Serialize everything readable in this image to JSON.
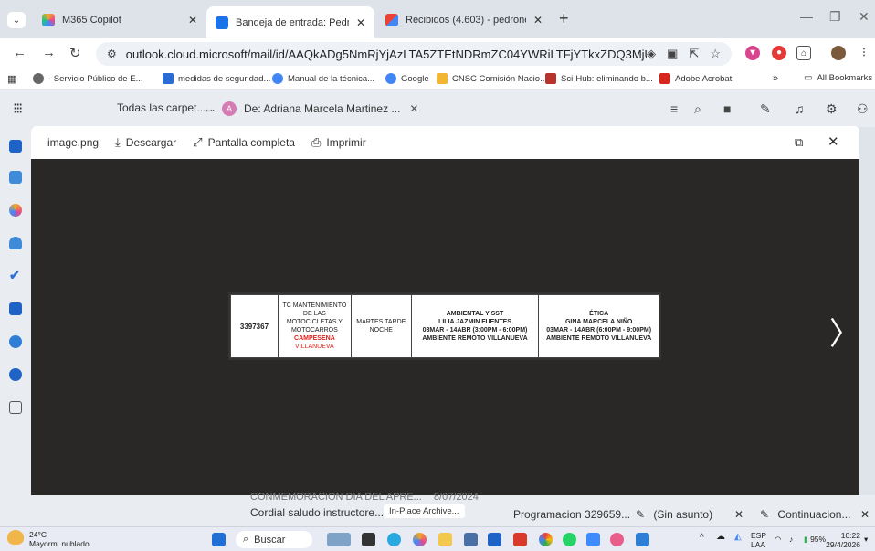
{
  "browser": {
    "tabs": [
      {
        "title": "M365 Copilot",
        "active": false
      },
      {
        "title": "Bandeja de entrada: Pedro Nel Ca",
        "active": true
      },
      {
        "title": "Recibidos (4.603) - pedronel.castr",
        "active": false
      }
    ],
    "new_tab": "+",
    "url": "outlook.cloud.microsoft/mail/id/AAQkADg5NmRjYjAzLTA5ZTEtNDRmZC04YWRiLTFjYTkxZDQ3MjUwYQAQAGj%..."
  },
  "bookmarks": [
    "- Servicio Público de E...",
    "medidas de seguridad...",
    "Manual de la técnica...",
    "Google",
    "CNSC Comisión Nacio...",
    "Sci-Hub: eliminando b...",
    "Adobe Acrobat"
  ],
  "bookmarks_more": "»",
  "all_bookmarks": "All Bookmarks",
  "outlook": {
    "folder_picker": "Todas las carpet...",
    "from_chip_initial": "A",
    "from_chip": "De: Adriana Marcela Martinez ...",
    "viewer": {
      "filename": "image.png",
      "download": "Descargar",
      "fullscreen": "Pantalla completa",
      "print": "Imprimir"
    }
  },
  "schedule_table": {
    "code": "3397367",
    "program": [
      "TC MANTENIMIENTO",
      "DE LAS",
      "MOTOCICLETAS Y",
      "MOTOCARROS"
    ],
    "program_red": [
      "CAMPESENA",
      "VILLANUEVA"
    ],
    "shift": [
      "MARTES TARDE",
      "NOCHE"
    ],
    "col1": [
      "AMBIENTAL Y SST",
      "LILIA JAZMIN FUENTES",
      "03MAR - 14ABR (3:00PM - 6:00PM)",
      "AMBIENTE REMOTO VILLANUEVA"
    ],
    "col2": [
      "ÉTICA",
      "GINA MARCELA NIÑO",
      "03MAR - 14ABR (6:00PM - 9:00PM)",
      "AMBIENTE REMOTO VILLANUEVA"
    ]
  },
  "mail_list": {
    "item_title": "CONMEMORACION DIA DEL APRE...",
    "item_date": "8/07/2024",
    "item_preview": "Cordial saludo instructore...",
    "item_tag": "In-Place Archive..."
  },
  "bottom_tabs": [
    {
      "label": "Programacion 329659..."
    },
    {
      "label": "(Sin asunto)"
    },
    {
      "label": "Continuacion..."
    }
  ],
  "taskbar": {
    "weather_temp": "24°C",
    "weather_desc": "Mayorm. nublado",
    "search": "Buscar",
    "lang": "ESP",
    "lang2": "LAA",
    "battery": "95%",
    "time": "10:22",
    "date": "29/4/2026"
  }
}
